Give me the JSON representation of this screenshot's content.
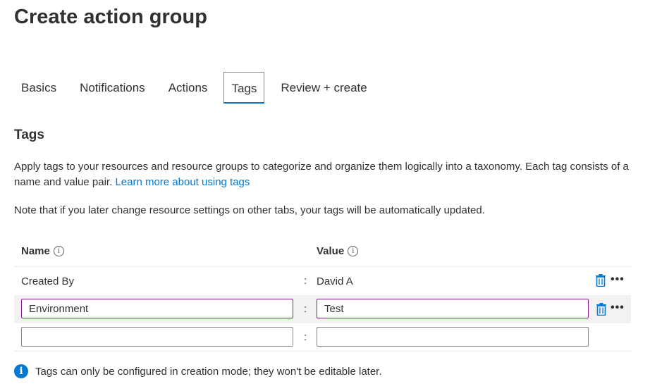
{
  "page": {
    "title": "Create action group"
  },
  "tabs": [
    {
      "label": "Basics"
    },
    {
      "label": "Notifications"
    },
    {
      "label": "Actions"
    },
    {
      "label": "Tags"
    },
    {
      "label": "Review + create"
    }
  ],
  "active_tab": "Tags",
  "section": {
    "title": "Tags",
    "description": "Apply tags to your resources and resource groups to categorize and organize them logically into a taxonomy. Each tag consists of a name and value pair.",
    "learn_more": "Learn more about using tags",
    "note": "Note that if you later change resource settings on other tabs, your tags will be automatically updated."
  },
  "table": {
    "name_header": "Name",
    "value_header": "Value",
    "separator": ":",
    "rows": [
      {
        "name": "Created By",
        "value": "David A"
      },
      {
        "name": "Environment",
        "value": "Test"
      },
      {
        "name": "",
        "value": ""
      }
    ],
    "more_label": "•••"
  },
  "footer": {
    "message": "Tags can only be configured in creation mode; they won't be editable later."
  },
  "colors": {
    "accent": "#0078d4",
    "focus_border": "#8a1d94"
  },
  "icons": [
    "info-icon",
    "trash-icon",
    "more-icon"
  ]
}
